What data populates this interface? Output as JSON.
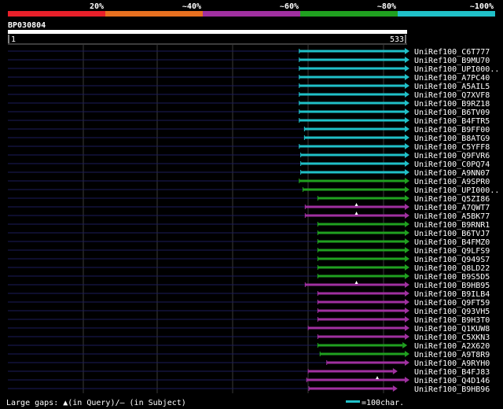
{
  "query_id": "BP030804",
  "ruler": {
    "start": "1",
    "end": "533",
    "length": 533
  },
  "scale": [
    {
      "label": "20%",
      "color": "#e8202a"
    },
    {
      "label": "~40%",
      "color": "#e87020"
    },
    {
      "label": "~60%",
      "color": "#a030a0"
    },
    {
      "label": "~80%",
      "color": "#20a020"
    },
    {
      "label": "~100%",
      "color": "#20c0c8"
    }
  ],
  "hits": [
    {
      "name": "UniRef100_C6T777",
      "start": 391,
      "end": 533,
      "color": "cyan"
    },
    {
      "name": "UniRef100_B9MU70",
      "start": 391,
      "end": 533,
      "color": "cyan"
    },
    {
      "name": "UniRef100_UPI000..",
      "start": 391,
      "end": 533,
      "color": "cyan"
    },
    {
      "name": "UniRef100_A7PC40",
      "start": 391,
      "end": 533,
      "color": "cyan"
    },
    {
      "name": "UniRef100_A5AIL5",
      "start": 391,
      "end": 533,
      "color": "cyan"
    },
    {
      "name": "UniRef100_Q7XVF8",
      "start": 391,
      "end": 533,
      "color": "cyan"
    },
    {
      "name": "UniRef100_B9RZ18",
      "start": 391,
      "end": 533,
      "color": "cyan"
    },
    {
      "name": "UniRef100_B6TV09",
      "start": 391,
      "end": 533,
      "color": "cyan"
    },
    {
      "name": "UniRef100_B4FTR5",
      "start": 391,
      "end": 533,
      "color": "cyan"
    },
    {
      "name": "UniRef100_B9FF00",
      "start": 398,
      "end": 533,
      "color": "cyan"
    },
    {
      "name": "UniRef100_B8ATG9",
      "start": 398,
      "end": 533,
      "color": "cyan"
    },
    {
      "name": "UniRef100_C5YFF8",
      "start": 391,
      "end": 533,
      "color": "cyan"
    },
    {
      "name": "UniRef100_Q9FVR6",
      "start": 393,
      "end": 533,
      "color": "cyan"
    },
    {
      "name": "UniRef100_C0PQ74",
      "start": 393,
      "end": 533,
      "color": "cyan"
    },
    {
      "name": "UniRef100_A9NN07",
      "start": 393,
      "end": 533,
      "color": "cyan"
    },
    {
      "name": "UniRef100_A9SPR0",
      "start": 391,
      "end": 533,
      "color": "green"
    },
    {
      "name": "UniRef100_UPI000..",
      "start": 396,
      "end": 533,
      "color": "green"
    },
    {
      "name": "UniRef100_Q5ZI86",
      "start": 416,
      "end": 533,
      "color": "green"
    },
    {
      "name": "UniRef100_A7QWT7",
      "start": 399,
      "end": 533,
      "color": "purple",
      "qgap": [
        468
      ]
    },
    {
      "name": "UniRef100_A5BK77",
      "start": 399,
      "end": 533,
      "color": "purple",
      "qgap": [
        468
      ]
    },
    {
      "name": "UniRef100_B9RNR1",
      "start": 416,
      "end": 533,
      "color": "green"
    },
    {
      "name": "UniRef100_B6TVJ7",
      "start": 416,
      "end": 533,
      "color": "green"
    },
    {
      "name": "UniRef100_B4FMZ0",
      "start": 416,
      "end": 533,
      "color": "green"
    },
    {
      "name": "UniRef100_Q9LFS9",
      "start": 416,
      "end": 533,
      "color": "green"
    },
    {
      "name": "UniRef100_Q949S7",
      "start": 416,
      "end": 533,
      "color": "green"
    },
    {
      "name": "UniRef100_Q8LD22",
      "start": 416,
      "end": 533,
      "color": "green"
    },
    {
      "name": "UniRef100_B9S5D5",
      "start": 416,
      "end": 533,
      "color": "green"
    },
    {
      "name": "UniRef100_B9HB95",
      "start": 399,
      "end": 533,
      "color": "purple",
      "qgap": [
        468
      ]
    },
    {
      "name": "UniRef100_B9ILB4",
      "start": 416,
      "end": 533,
      "color": "purple"
    },
    {
      "name": "UniRef100_Q9FT59",
      "start": 416,
      "end": 533,
      "color": "purple"
    },
    {
      "name": "UniRef100_Q93VH5",
      "start": 416,
      "end": 533,
      "color": "purple"
    },
    {
      "name": "UniRef100_B9H3T0",
      "start": 416,
      "end": 533,
      "color": "purple"
    },
    {
      "name": "UniRef100_Q1KUW8",
      "start": 403,
      "end": 533,
      "color": "purple"
    },
    {
      "name": "UniRef100_C5XKN3",
      "start": 416,
      "end": 533,
      "color": "purple"
    },
    {
      "name": "UniRef100_A2X620",
      "start": 416,
      "end": 530,
      "color": "green"
    },
    {
      "name": "UniRef100_A9T8R9",
      "start": 419,
      "end": 533,
      "color": "green"
    },
    {
      "name": "UniRef100_A9RYH0",
      "start": 428,
      "end": 533,
      "color": "purple"
    },
    {
      "name": "UniRef100_B4FJ83",
      "start": 403,
      "end": 517,
      "color": "purple"
    },
    {
      "name": "UniRef100_Q4D146",
      "start": 401,
      "end": 533,
      "color": "purple",
      "qgap": [
        496
      ]
    },
    {
      "name": "UniRef100_B9HB96",
      "start": 404,
      "end": 517,
      "color": "purple"
    }
  ],
  "footer": {
    "legend_text": "Large gaps: ▲(in Query)/– (in Subject)",
    "bar_label": "=100char.",
    "bar_color": "#20c0c8"
  }
}
